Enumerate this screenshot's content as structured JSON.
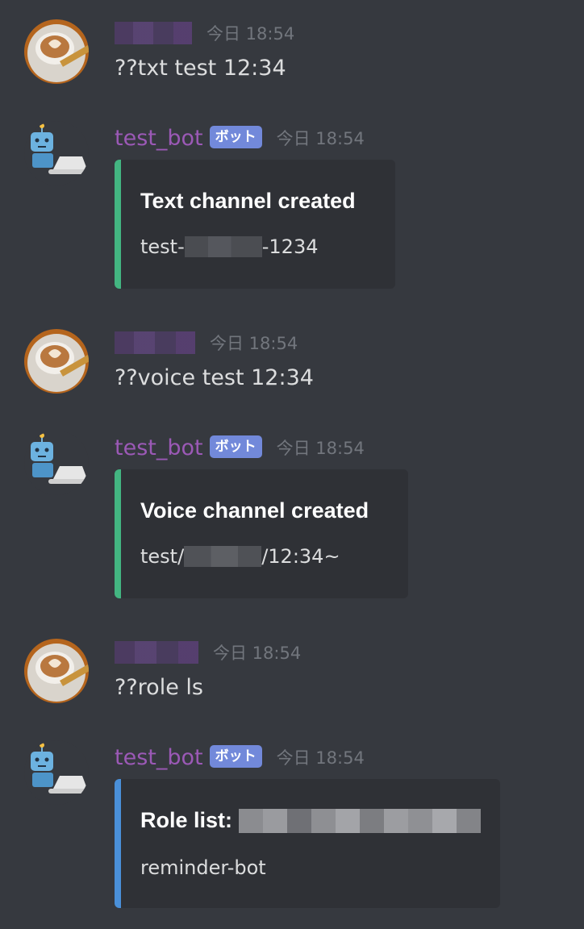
{
  "messages": [
    {
      "author_redacted": true,
      "time": "今日 18:54",
      "text": "??txt test 12:34"
    },
    {
      "author": "test_bot",
      "badge": "ボット",
      "time": "今日 18:54",
      "embed": {
        "title": "Text channel created",
        "desc_prefix": "test-",
        "desc_suffix": "-1234",
        "color": "#43b581"
      }
    },
    {
      "author_redacted": true,
      "time": "今日 18:54",
      "text": "??voice test 12:34"
    },
    {
      "author": "test_bot",
      "badge": "ボット",
      "time": "今日 18:54",
      "embed": {
        "title": "Voice channel created",
        "desc_prefix": "test/",
        "desc_suffix": "/12:34~",
        "color": "#43b581"
      }
    },
    {
      "author_redacted": true,
      "time": "今日 18:54",
      "text": "??role ls"
    },
    {
      "author": "test_bot",
      "badge": "ボット",
      "time": "今日 18:54",
      "embed": {
        "title": "Role list:",
        "desc": "reminder-bot",
        "color": "#4a90d9"
      }
    }
  ],
  "icons": {
    "user_avatar": "coffee-cup-icon",
    "bot_avatar": "robot-laptop-icon"
  }
}
